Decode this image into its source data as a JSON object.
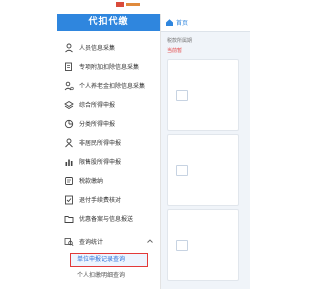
{
  "sidebar": {
    "header": "代扣代缴",
    "items": [
      {
        "label": "人员信息采集",
        "icon": "person-icon"
      },
      {
        "label": "专项附加扣除信息采集",
        "icon": "documents-icon"
      },
      {
        "label": "个人养老金扣除信息采集",
        "icon": "person-coin-icon"
      },
      {
        "label": "综合所得申报",
        "icon": "layers-icon"
      },
      {
        "label": "分类所得申报",
        "icon": "pie-icon"
      },
      {
        "label": "非居民所得申报",
        "icon": "person-outline-icon"
      },
      {
        "label": "限售股所得申报",
        "icon": "bar-chart-icon"
      },
      {
        "label": "税款缴纳",
        "icon": "receipt-icon"
      },
      {
        "label": "退付手续费核对",
        "icon": "check-doc-icon"
      },
      {
        "label": "优惠备案与信息报送",
        "icon": "folder-icon"
      }
    ],
    "query_group": {
      "label": "查询统计",
      "icon": "query-icon",
      "chevron": "chevron-up-icon",
      "children": [
        {
          "label": "单位申报记录查询",
          "active": true
        },
        {
          "label": "个人扣缴明细查询",
          "active": false
        }
      ]
    }
  },
  "content": {
    "home_label": "首页",
    "breadcrumb": "税款所属期",
    "alert": "当前暂"
  },
  "colors": {
    "accent": "#2f86de",
    "highlight": "#e23a3a"
  }
}
